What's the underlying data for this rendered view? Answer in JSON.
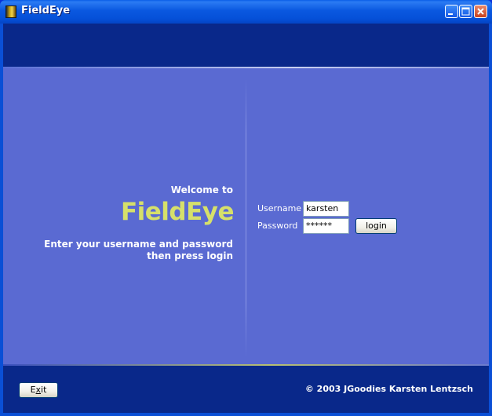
{
  "window": {
    "title": "FieldEye",
    "app_icon": "app-icon",
    "controls": [
      "minimize-icon",
      "maximize-icon",
      "close-icon"
    ]
  },
  "welcome": {
    "greeting": "Welcome to",
    "brand": "FieldEye",
    "instructions_line1": "Enter your username and password",
    "instructions_line2": "then press login"
  },
  "login_form": {
    "username_label": "Username",
    "username_value": "karsten",
    "password_label": "Password",
    "password_value": "******",
    "login_button": "login"
  },
  "footer": {
    "exit_button_pre": "E",
    "exit_button_mnemonic": "x",
    "exit_button_post": "it",
    "copyright": "© 2003 JGoodies Karsten Lentzsch"
  },
  "colors": {
    "title_bar": "#0550d8",
    "header_band": "#09288a",
    "panel": "#5a6ad2",
    "brand_text": "#d6e06a"
  }
}
